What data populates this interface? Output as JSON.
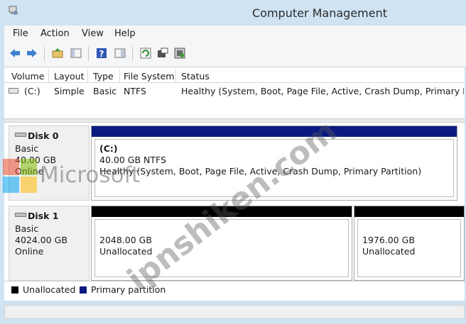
{
  "window": {
    "title": "Computer Management"
  },
  "menu": [
    "File",
    "Action",
    "View",
    "Help"
  ],
  "toolbar": {
    "buttons": [
      "back-arrow-icon",
      "forward-arrow-icon",
      "up-folder-icon",
      "show-hide-tree-icon",
      "help-icon",
      "properties-icon",
      "refresh-icon",
      "settings-icon",
      "export-icon"
    ]
  },
  "volumes": {
    "columns": [
      "Volume",
      "Layout",
      "Type",
      "File System",
      "Status"
    ],
    "rows": [
      {
        "volume": "(C:)",
        "layout": "Simple",
        "type": "Basic",
        "file_system": "NTFS",
        "status": "Healthy (System, Boot, Page File, Active, Crash Dump, Primary Parti"
      }
    ]
  },
  "disks": [
    {
      "name": "Disk 0",
      "type": "Basic",
      "size": "40.00 GB",
      "state": "Online",
      "partitions": [
        {
          "label": "(C:)",
          "size": "40.00 GB NTFS",
          "status": "Healthy (System, Boot, Page File, Active, Crash Dump, Primary Partition)",
          "kind": "primary"
        }
      ]
    },
    {
      "name": "Disk 1",
      "type": "Basic",
      "size": "4024.00 GB",
      "state": "Online",
      "partitions": [
        {
          "size": "2048.00 GB",
          "status": "Unallocated",
          "kind": "unallocated"
        },
        {
          "size": "1976.00 GB",
          "status": "Unallocated",
          "kind": "unallocated"
        }
      ]
    }
  ],
  "legend": [
    {
      "label": "Unallocated",
      "color": "#000000"
    },
    {
      "label": "Primary partition",
      "color": "#0a1a80"
    }
  ],
  "watermarks": {
    "brand": "Microsoft",
    "site": "ipnshiken.com"
  },
  "colors": {
    "primary_bar": "#0a1a80",
    "unallocated_bar": "#000000",
    "chrome": "#cfe3f3"
  }
}
